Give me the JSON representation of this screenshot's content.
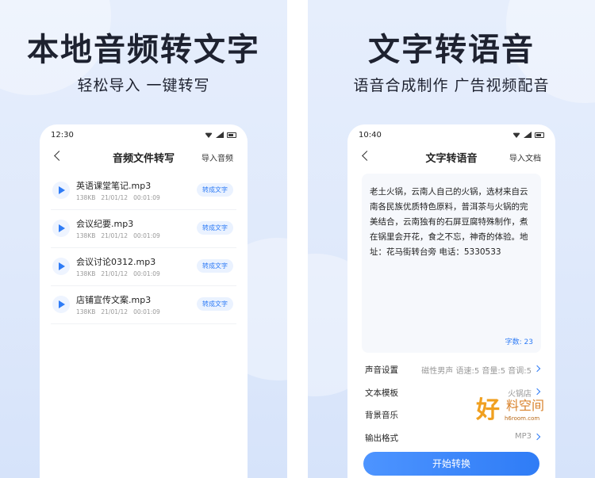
{
  "left_panel": {
    "headline": "本地音频转文字",
    "subline": "轻松导入  一键转写",
    "phone": {
      "status_time": "12:30",
      "title": "音频文件转写",
      "action": "导入音频",
      "files": [
        {
          "name": "英语课堂笔记.mp3",
          "size": "138KB",
          "date": "21/01/12",
          "duration": "00:01:09",
          "button": "转成文字"
        },
        {
          "name": "会议纪要.mp3",
          "size": "138KB",
          "date": "21/01/12",
          "duration": "00:01:09",
          "button": "转成文字"
        },
        {
          "name": "会议讨论0312.mp3",
          "size": "138KB",
          "date": "21/01/12",
          "duration": "00:01:09",
          "button": "转成文字"
        },
        {
          "name": "店铺宣传文案.mp3",
          "size": "138KB",
          "date": "21/01/12",
          "duration": "00:01:09",
          "button": "转成文字"
        }
      ]
    }
  },
  "right_panel": {
    "headline": "文字转语音",
    "subline": "语音合成制作  广告视频配音",
    "phone": {
      "status_time": "10:40",
      "title": "文字转语音",
      "action": "导入文档",
      "text": "老土火锅，云南人自己的火锅，选材来自云南各民族优质特色原料，普洱茶与火锅的完美结合，云南独有的石屏豆腐特殊制作，煮在锅里会开花，食之不忘，神奇的体验。地址：花马街转台旁  电话：5330533",
      "word_count": "字数: 23",
      "settings": [
        {
          "label": "声音设置",
          "value": "磁性男声  语速:5  音量:5  音调:5"
        },
        {
          "label": "文本模板",
          "value": "火锅店"
        },
        {
          "label": "背景音乐",
          "value": ""
        },
        {
          "label": "输出格式",
          "value": "MP3"
        }
      ],
      "start_button": "开始转换"
    }
  },
  "watermark": {
    "mark": "好",
    "text": "料空间",
    "url": "h6room.com"
  }
}
